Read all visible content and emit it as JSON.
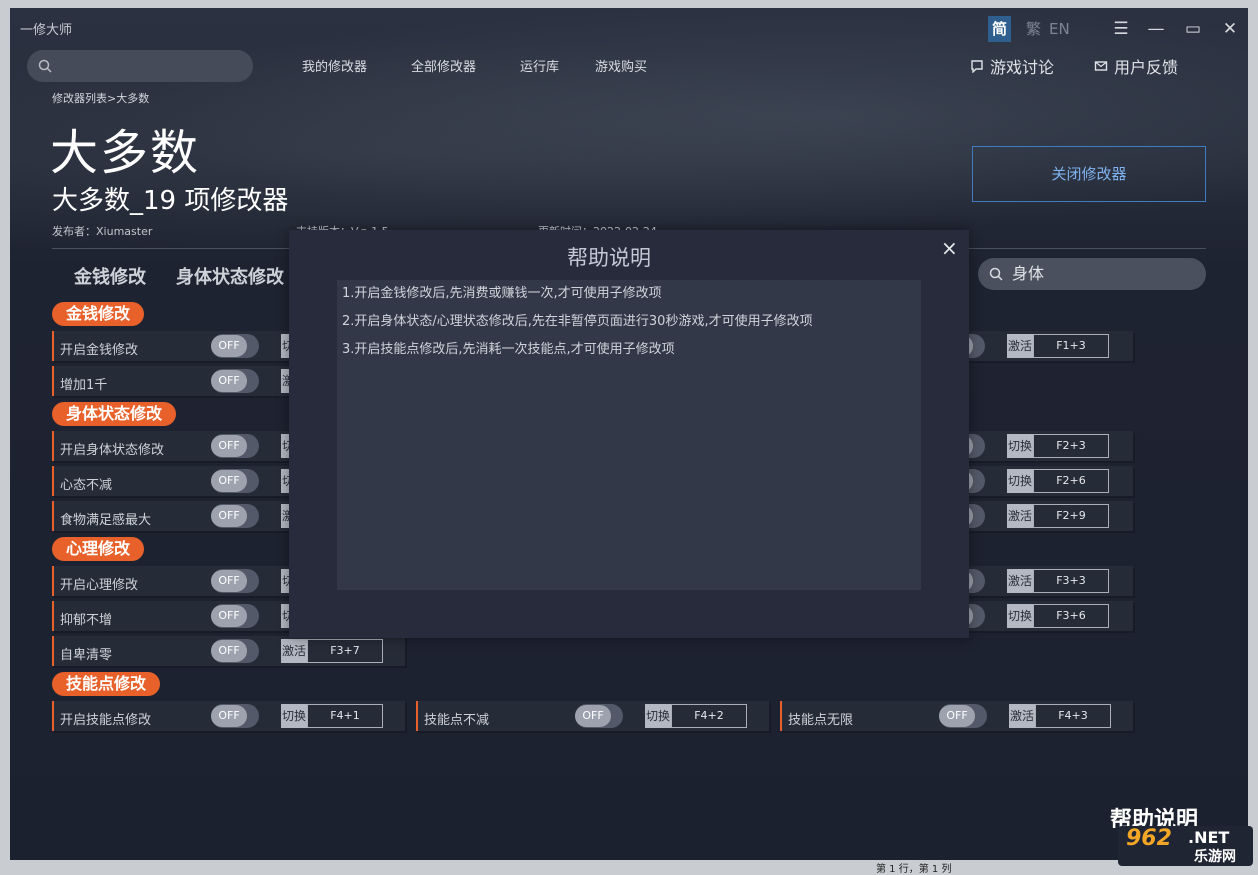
{
  "app_name": "一修大师",
  "lang": {
    "zh_s": "简",
    "zh_t": "繁",
    "en": "EN"
  },
  "window": {
    "menu": "☰",
    "min": "—",
    "max": "▭",
    "close": "✕"
  },
  "nav": [
    "我的修改器",
    "全部修改器",
    "运行库",
    "游戏购买"
  ],
  "header_links": {
    "discuss": "游戏讨论",
    "feedback": "用户反馈"
  },
  "breadcrumb": "修改器列表>大多数",
  "game_title": "大多数",
  "trainer_title": "大多数_19 项修改器",
  "publisher": "发布者：Xiumaster",
  "version": "支持版本：V.p.1.5",
  "updated": "更新时间：2022-02-24",
  "close_trainer": "关闭修改器",
  "tabs": [
    "金钱修改",
    "身体状态修改"
  ],
  "search_value": "身体",
  "sections": {
    "money": "金钱修改",
    "body": "身体状态修改",
    "mind": "心理修改",
    "skill": "技能点修改"
  },
  "toggle_off": "OFF",
  "rows": {
    "r1": {
      "label": "开启金钱修改",
      "mode": "切换"
    },
    "r2": {
      "label": "增加1千",
      "mode": "激活"
    },
    "r3": {
      "label": "开启身体状态修改",
      "mode": "切换"
    },
    "r4": {
      "label": "心态不减",
      "mode": "切换"
    },
    "r5": {
      "label": "食物满足感最大",
      "mode": "激活"
    },
    "r6": {
      "label": "开启心理修改",
      "mode": "切换"
    },
    "r7": {
      "label": "抑郁不增",
      "mode": "切换"
    },
    "r8": {
      "label": "自卑清零",
      "mode": "激活",
      "key": "F3+7"
    },
    "r9": {
      "label": "开启技能点修改",
      "mode": "切换",
      "key": "F4+1"
    },
    "r10": {
      "label": "技能点不减",
      "mode": "切换",
      "key": "F4+2"
    },
    "r11": {
      "label": "技能点无限",
      "mode": "激活",
      "key": "F4+3"
    }
  },
  "right_keys": [
    {
      "mode": "激活",
      "key": "F1+3"
    },
    {
      "mode": "切换",
      "key": "F2+3"
    },
    {
      "mode": "切换",
      "key": "F2+6"
    },
    {
      "mode": "激活",
      "key": "F2+9"
    },
    {
      "mode": "激活",
      "key": "F3+3"
    },
    {
      "mode": "切换",
      "key": "F3+6"
    }
  ],
  "modal": {
    "title": "帮助说明",
    "close": "×",
    "lines": [
      "1.开启金钱修改后,先消费或赚钱一次,才可使用子修改项",
      "2.开启身体状态/心理状态修改后,先在非暂停页面进行30秒游戏,才可使用子修改项",
      "3.开启技能点修改后,先消耗一次技能点,才可使用子修改项"
    ]
  },
  "help_link": "帮助说明",
  "watermark": {
    "text1": "962",
    "text2": ".NET",
    "text3": "乐游网"
  },
  "status": "第 1 行，第 1 列"
}
